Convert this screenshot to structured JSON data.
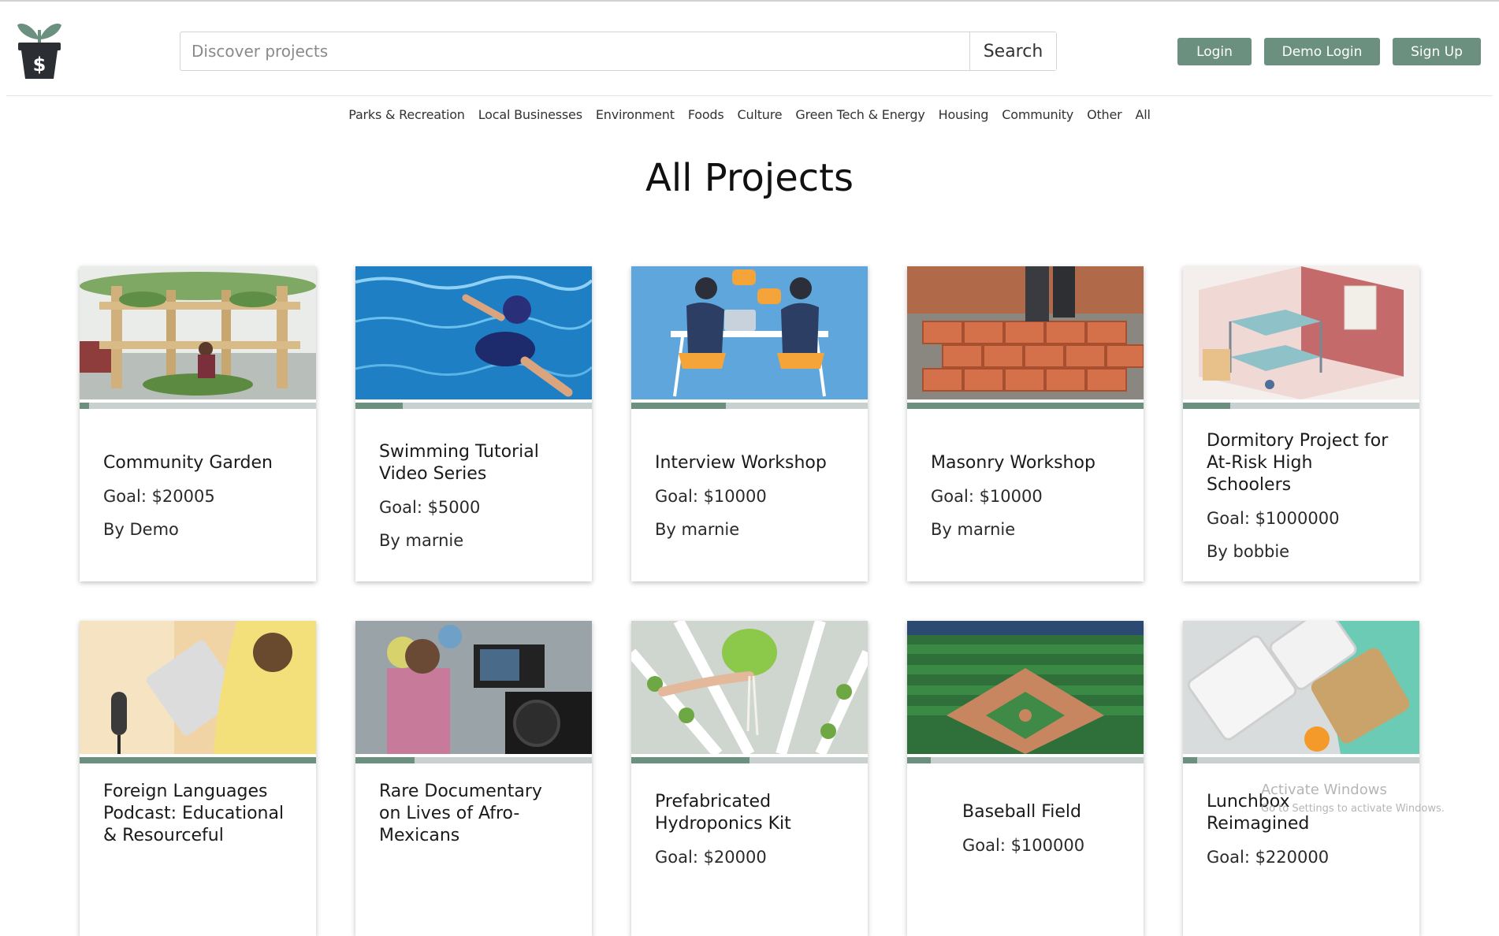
{
  "search": {
    "placeholder": "Discover projects",
    "button_label": "Search"
  },
  "auth": {
    "login": "Login",
    "demo_login": "Demo Login",
    "sign_up": "Sign Up"
  },
  "categories": [
    "Parks & Recreation",
    "Local Businesses",
    "Environment",
    "Foods",
    "Culture",
    "Green Tech & Energy",
    "Housing",
    "Community",
    "Other",
    "All"
  ],
  "page_title": "All Projects",
  "projects": [
    {
      "title": "Community Garden",
      "goal": "Goal: $20005",
      "author": "By Demo",
      "progress": 0.04,
      "image_icon": "garden-photo"
    },
    {
      "title": "Swimming Tutorial Video Series",
      "goal": "Goal: $5000",
      "author": "By marnie",
      "progress": 0.2,
      "image_icon": "swimmer-photo"
    },
    {
      "title": "Interview Workshop",
      "goal": "Goal: $10000",
      "author": "By marnie",
      "progress": 0.4,
      "image_icon": "interview-illustration"
    },
    {
      "title": "Masonry Workshop",
      "goal": "Goal: $10000",
      "author": "By marnie",
      "progress": 1.0,
      "image_icon": "bricklaying-photo"
    },
    {
      "title": "Dormitory Project for At-Risk High Schoolers",
      "goal": "Goal: $1000000",
      "author": "By bobbie",
      "progress": 0.2,
      "image_icon": "dorm-room-illustration"
    },
    {
      "title": "Foreign Languages Podcast: Educational & Resourceful",
      "goal": "",
      "author": "",
      "progress": 1.0,
      "image_icon": "podcast-photo"
    },
    {
      "title": "Rare Documentary on Lives of Afro-Mexicans",
      "goal": "",
      "author": "",
      "progress": 0.25,
      "image_icon": "camera-photo"
    },
    {
      "title": "Prefabricated Hydroponics Kit",
      "goal": "Goal: $20000",
      "author": "",
      "progress": 0.5,
      "image_icon": "hydroponics-photo"
    },
    {
      "title": "Baseball Field",
      "goal": "Goal: $100000",
      "author": "",
      "progress": 0.1,
      "image_icon": "baseball-field-photo"
    },
    {
      "title": "Lunchbox Reimagined",
      "goal": "Goal: $220000",
      "author": "",
      "progress": 0.06,
      "image_icon": "lunchbox-photo"
    }
  ],
  "watermark": {
    "line1": "Activate Windows",
    "line2": "Go to Settings to activate Windows."
  },
  "colors": {
    "accent": "#6b9080",
    "track": "#c9d0d0",
    "logo_leaf": "#6b9080",
    "logo_pot": "#2b2f33"
  }
}
